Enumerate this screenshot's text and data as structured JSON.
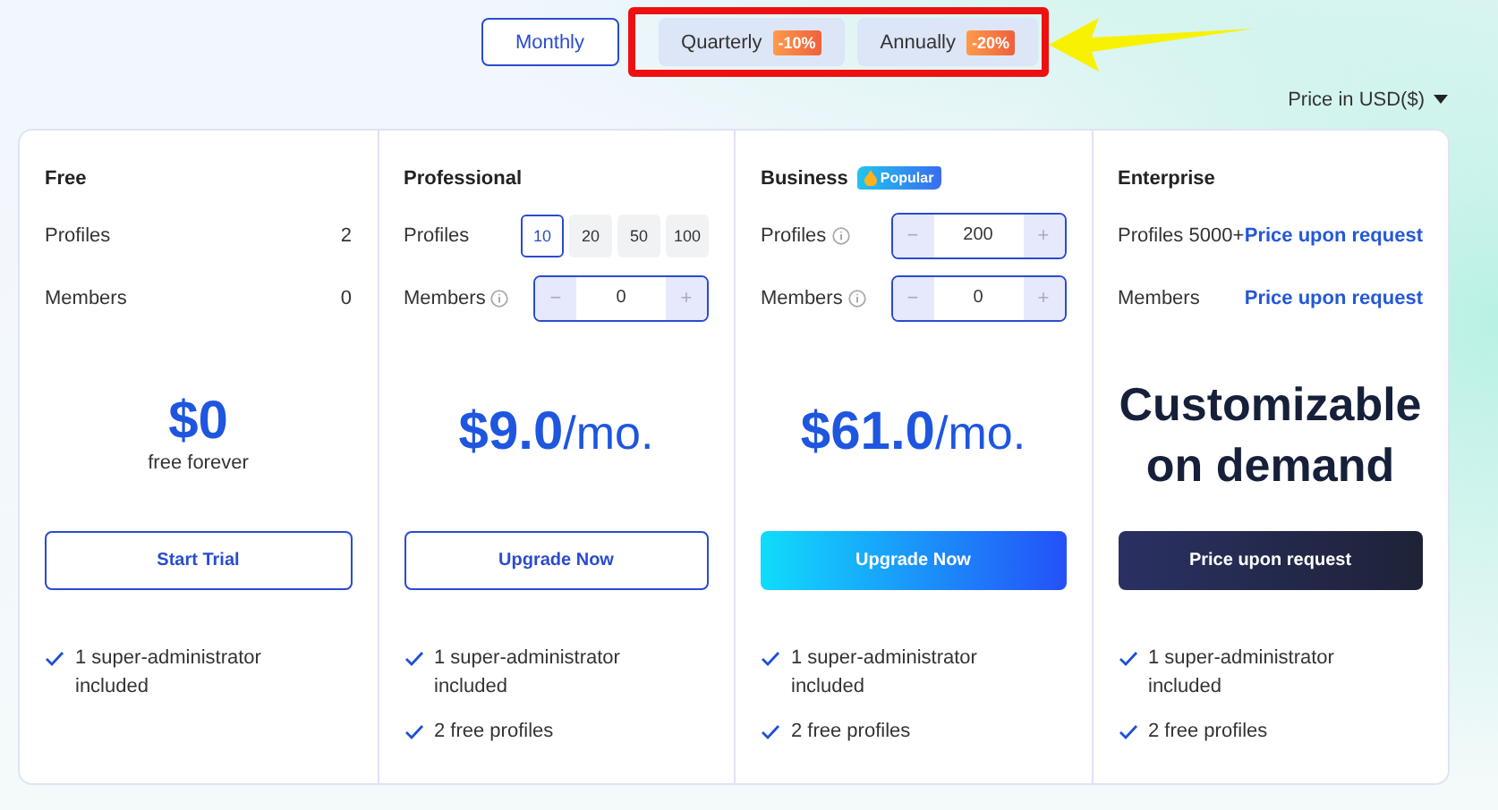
{
  "billing_tabs": [
    {
      "label": "Monthly",
      "selected": true
    },
    {
      "label": "Quarterly",
      "badge": "-10%",
      "selected": false
    },
    {
      "label": "Annually",
      "badge": "-20%",
      "selected": false
    }
  ],
  "currency": {
    "label": "Price in USD($)"
  },
  "plans": [
    {
      "name": "Free",
      "rows": [
        {
          "kind": "value",
          "label": "Profiles",
          "info": false,
          "value": "2"
        },
        {
          "kind": "value",
          "label": "Members",
          "info": false,
          "value": "0"
        }
      ],
      "price": {
        "kind": "amount",
        "amount": "$0",
        "note": "free forever"
      },
      "button": {
        "label": "Start Trial",
        "kind": "outline"
      },
      "features": [
        "1 super-administrator included"
      ]
    },
    {
      "name": "Professional",
      "rows": [
        {
          "kind": "options",
          "label": "Profiles",
          "info": false,
          "options": [
            {
              "label": "10",
              "selected": true
            },
            {
              "label": "20",
              "selected": false
            },
            {
              "label": "50",
              "selected": false
            },
            {
              "label": "100",
              "selected": false
            }
          ]
        },
        {
          "kind": "stepper",
          "label": "Members",
          "info": true,
          "minus": "−",
          "value": "0",
          "plus": "+"
        }
      ],
      "price": {
        "kind": "amount",
        "amount": "$9.0",
        "unit": "/mo."
      },
      "button": {
        "label": "Upgrade Now",
        "kind": "outline"
      },
      "features": [
        "1 super-administrator included",
        "2 free profiles"
      ]
    },
    {
      "name": "Business",
      "badge": "Popular",
      "rows": [
        {
          "kind": "stepper",
          "label": "Profiles",
          "info": true,
          "minus": "−",
          "value": "200",
          "plus": "+"
        },
        {
          "kind": "stepper",
          "label": "Members",
          "info": true,
          "minus": "−",
          "value": "0",
          "plus": "+"
        }
      ],
      "price": {
        "kind": "amount",
        "amount": "$61.0",
        "unit": "/mo."
      },
      "button": {
        "label": "Upgrade Now",
        "kind": "gradient"
      },
      "features": [
        "1 super-administrator included",
        "2 free profiles"
      ]
    },
    {
      "name": "Enterprise",
      "rows": [
        {
          "kind": "link",
          "label": "Profiles 5000+",
          "info": false,
          "value": "Price upon request"
        },
        {
          "kind": "link",
          "label": "Members",
          "info": false,
          "value": "Price upon request"
        }
      ],
      "price": {
        "kind": "text",
        "text": "Customizable on demand"
      },
      "button": {
        "label": "Price upon request",
        "kind": "dark"
      },
      "features": [
        "1 super-administrator included",
        "2 free profiles"
      ]
    }
  ]
}
